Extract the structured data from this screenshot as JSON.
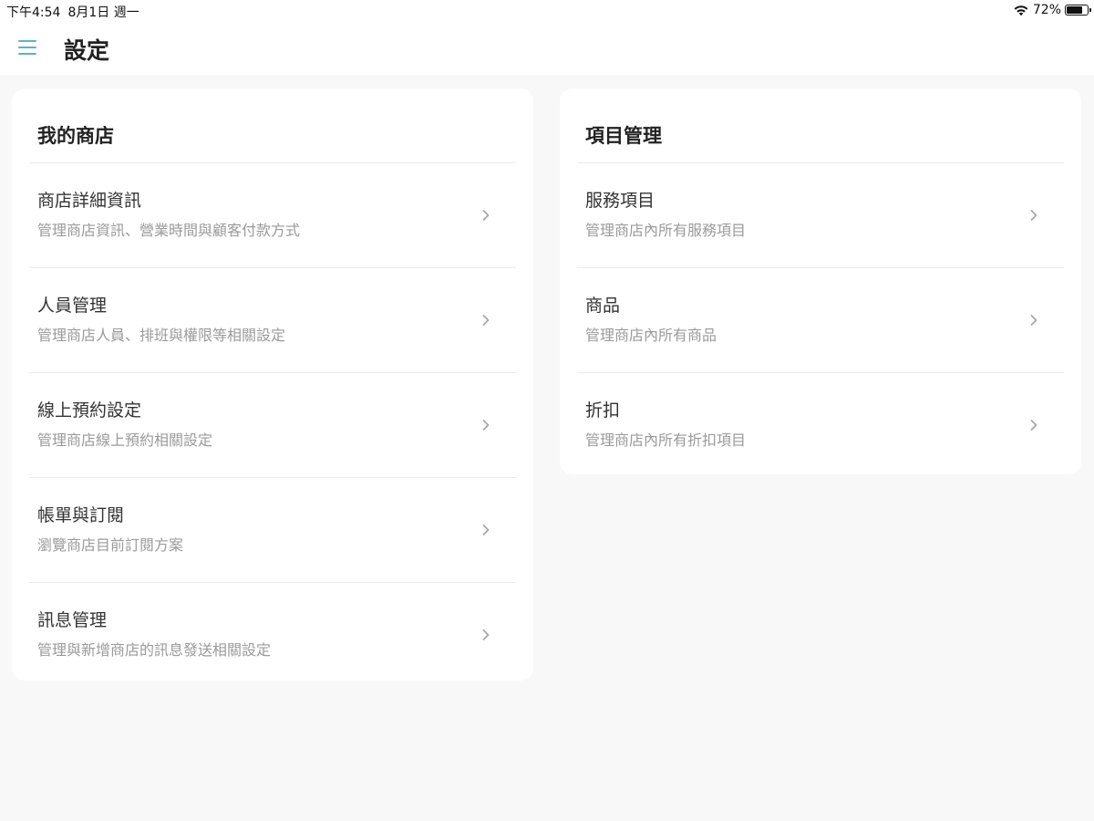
{
  "status_bar": {
    "time": "下午4:54",
    "date": "8月1日 週一",
    "battery_percent": "72%",
    "battery_level": 0.72,
    "icons": [
      "wifi-icon",
      "battery-icon"
    ]
  },
  "header": {
    "title": "設定",
    "menu_icon": "menu-icon",
    "accent_color": "#5ab4c8"
  },
  "my_store": {
    "title": "我的商店",
    "items": [
      {
        "title": "商店詳細資訊",
        "subtitle": "管理商店資訊、營業時間與顧客付款方式"
      },
      {
        "title": "人員管理",
        "subtitle": "管理商店人員、排班與權限等相關設定"
      },
      {
        "title": "線上預約設定",
        "subtitle": "管理商店線上預約相關設定"
      },
      {
        "title": "帳單與訂閱",
        "subtitle": "瀏覽商店目前訂閱方案"
      },
      {
        "title": "訊息管理",
        "subtitle": "管理與新增商店的訊息發送相關設定"
      }
    ]
  },
  "item_management": {
    "title": "項目管理",
    "items": [
      {
        "title": "服務項目",
        "subtitle": "管理商店內所有服務項目"
      },
      {
        "title": "商品",
        "subtitle": "管理商店內所有商品"
      },
      {
        "title": "折扣",
        "subtitle": "管理商店內所有折扣項目"
      }
    ]
  }
}
